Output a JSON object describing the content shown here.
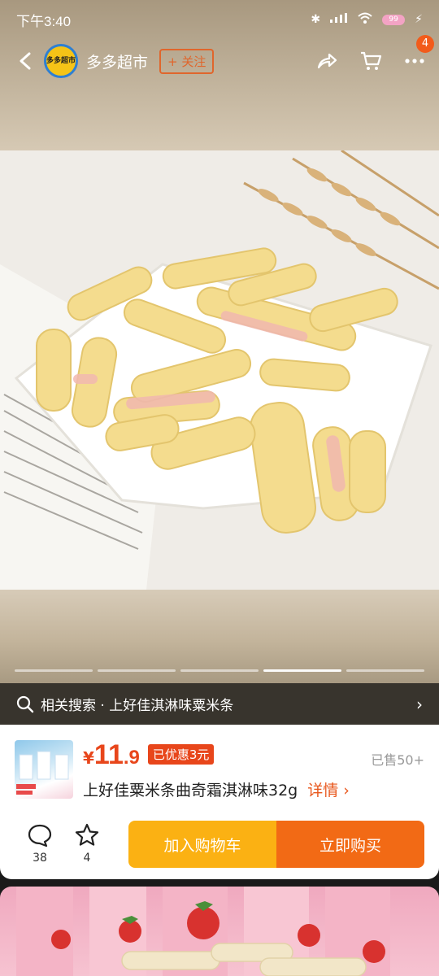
{
  "status_bar": {
    "time": "下午3:40",
    "battery": "99"
  },
  "nav": {
    "shop_name": "多多超市",
    "shop_logo_text": "多多超市",
    "follow_label": "+ 关注",
    "cart_badge": "4"
  },
  "carousel": {
    "count": 5,
    "active_index": 3
  },
  "related_search": {
    "label": "相关搜索 · 上好佳淇淋味粟米条"
  },
  "product": {
    "currency": "¥",
    "price_int": "11",
    "price_dec": ".9",
    "discount": "已优惠3元",
    "sold": "已售50+",
    "title": "上好佳粟米条曲奇霜淇淋味32g",
    "details_label": "详情 ›"
  },
  "actions": {
    "comments_count": "38",
    "favorites_count": "4",
    "add_to_cart": "加入购物车",
    "buy_now": "立即购买"
  },
  "colors": {
    "accent": "#e8461b",
    "cart_button": "#fbb113",
    "buy_button": "#f26a15"
  }
}
